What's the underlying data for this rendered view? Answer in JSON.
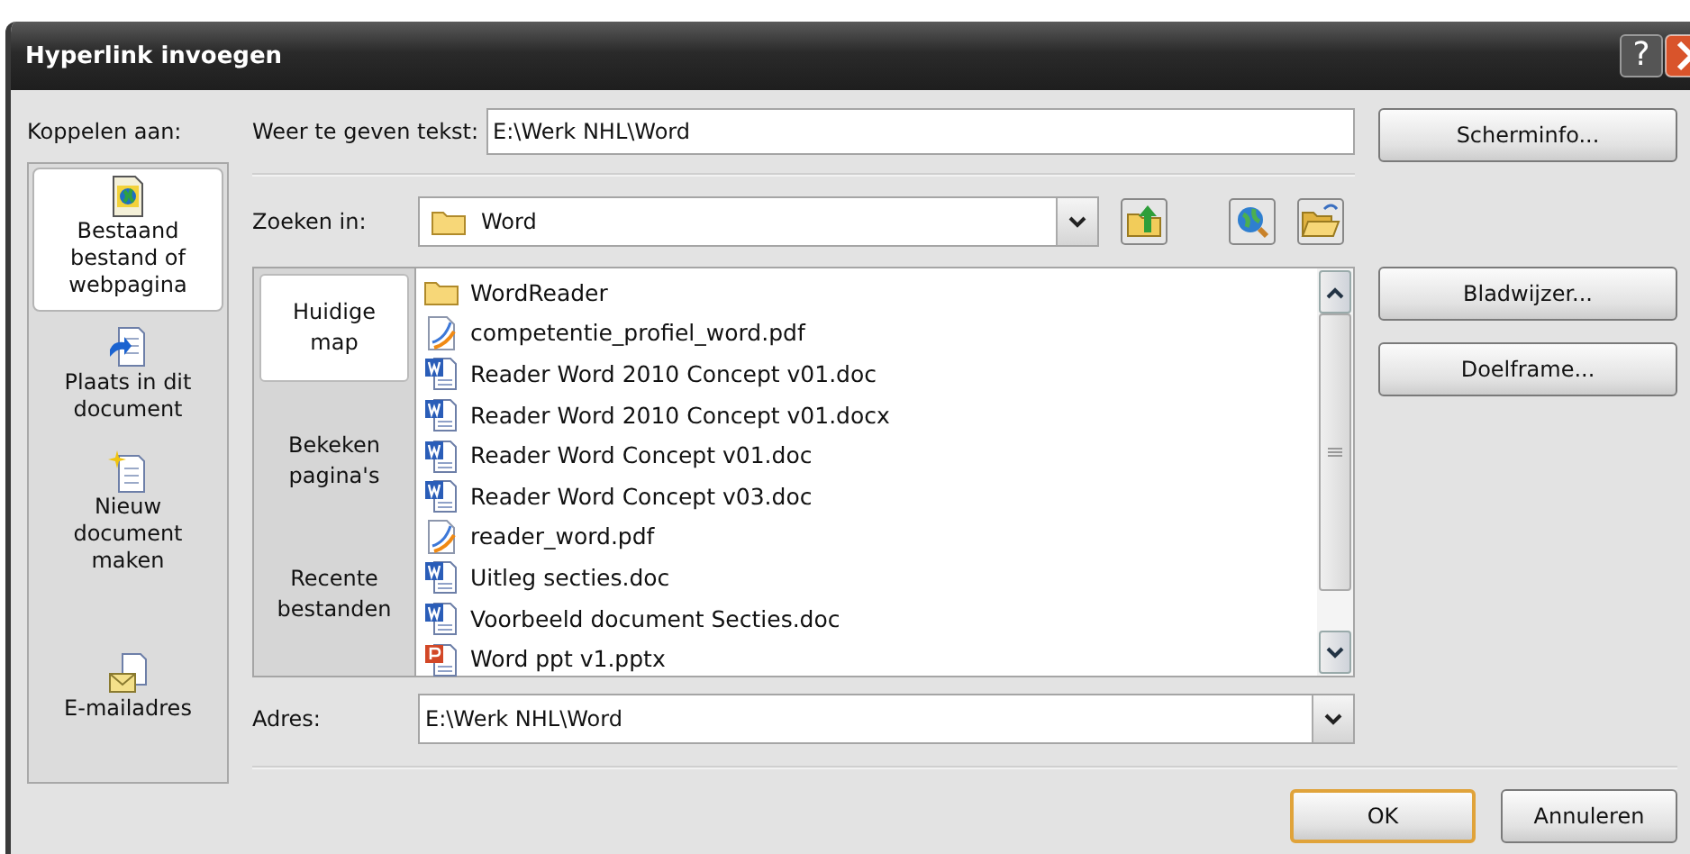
{
  "window": {
    "title": "Hyperlink invoegen",
    "help_button": "?"
  },
  "link_to": {
    "label": "Koppelen aan:",
    "items": [
      {
        "label": "Bestaand bestand of webpagina",
        "kind": "file",
        "selected": true
      },
      {
        "label": "Plaats in dit document",
        "kind": "place",
        "selected": false
      },
      {
        "label": "Nieuw document maken",
        "kind": "new",
        "selected": false
      },
      {
        "label": "E-mailadres",
        "kind": "email",
        "selected": false
      }
    ]
  },
  "display_text": {
    "label": "Weer te geven tekst:",
    "value": "E:\\Werk NHL\\Word"
  },
  "screen_tip_button": "Scherminfo...",
  "look_in": {
    "label": "Zoeken in:",
    "value": "Word"
  },
  "places": [
    {
      "label": "Huidige map",
      "selected": true
    },
    {
      "label": "Bekeken pagina's",
      "selected": false
    },
    {
      "label": "Recente bestanden",
      "selected": false
    }
  ],
  "files": [
    {
      "name": "WordReader",
      "kind": "folder"
    },
    {
      "name": "competentie_profiel_word.pdf",
      "kind": "pdf"
    },
    {
      "name": "Reader Word 2010 Concept v01.doc",
      "kind": "word"
    },
    {
      "name": "Reader Word 2010 Concept v01.docx",
      "kind": "word"
    },
    {
      "name": "Reader Word Concept v01.doc",
      "kind": "word"
    },
    {
      "name": "Reader Word Concept v03.doc",
      "kind": "word"
    },
    {
      "name": "reader_word.pdf",
      "kind": "pdf"
    },
    {
      "name": "Uitleg secties.doc",
      "kind": "word"
    },
    {
      "name": "Voorbeeld document Secties.doc",
      "kind": "word"
    },
    {
      "name": "Word ppt v1.pptx",
      "kind": "ppt"
    }
  ],
  "side_buttons": [
    "Bladwijzer...",
    "Doelframe..."
  ],
  "address": {
    "label": "Adres:",
    "value": "E:\\Werk NHL\\Word"
  },
  "buttons": [
    {
      "label": "OK",
      "default": true
    },
    {
      "label": "Annuleren",
      "default": false
    }
  ]
}
